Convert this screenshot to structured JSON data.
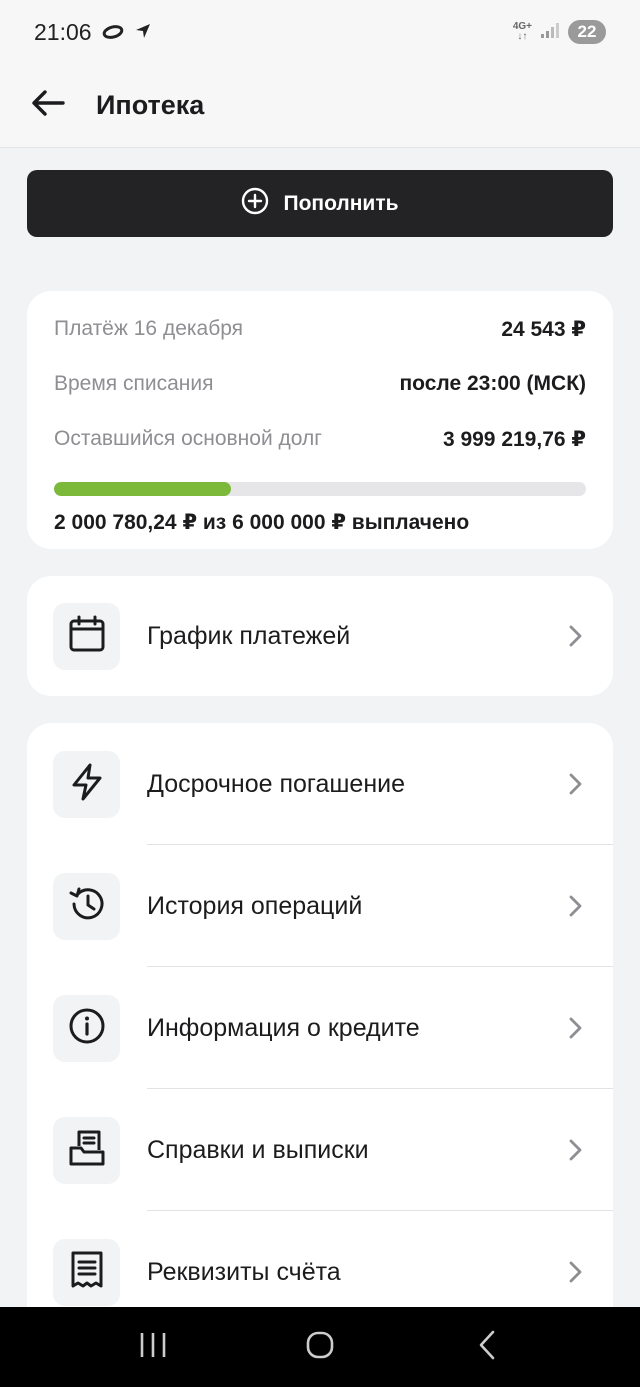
{
  "status_bar": {
    "time": "21:06",
    "network": "4G+",
    "battery": "22"
  },
  "header": {
    "title": "Ипотека"
  },
  "topup": {
    "label": "Пополнить"
  },
  "payment_info": {
    "rows": [
      {
        "label": "Платёж 16 декабря",
        "value": "24 543 ₽"
      },
      {
        "label": "Время списания",
        "value": "после 23:00 (МСК)"
      },
      {
        "label": "Оставшийся основной долг",
        "value": "3 999 219,76 ₽"
      }
    ],
    "progress_fraction": 0.3335,
    "paid_text": "2 000 780,24 ₽ из 6 000 000 ₽ выплачено",
    "progress_color": "#7cb83a"
  },
  "schedule": {
    "label": "График платежей",
    "icon": "calendar-icon"
  },
  "menu": {
    "items": [
      {
        "label": "Досрочное погашение",
        "icon": "lightning-icon"
      },
      {
        "label": "История операций",
        "icon": "history-icon"
      },
      {
        "label": "Информация о кредите",
        "icon": "info-icon"
      },
      {
        "label": "Справки и выписки",
        "icon": "documents-icon"
      },
      {
        "label": "Реквизиты счёта",
        "icon": "receipt-icon"
      }
    ]
  }
}
